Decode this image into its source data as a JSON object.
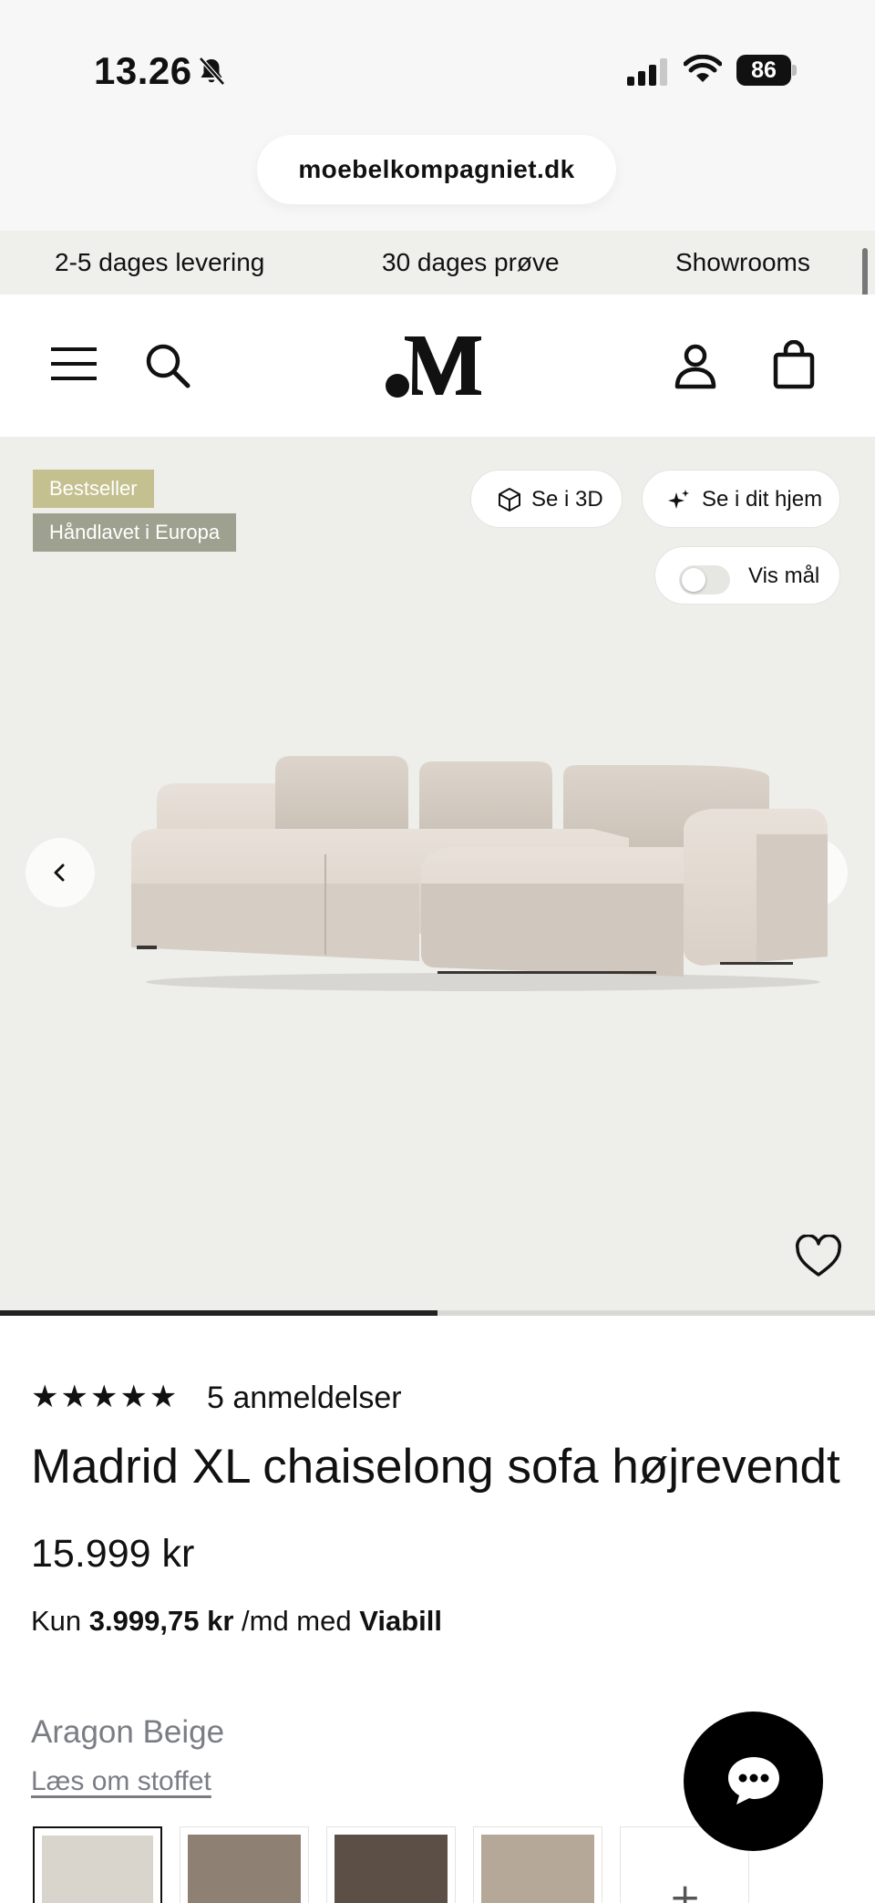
{
  "status_bar": {
    "time": "13.26",
    "battery": "86"
  },
  "browser": {
    "url": "moebelkompagniet.dk"
  },
  "usp_strip": {
    "items": [
      "2-5 dages levering",
      "30 dages prøve",
      "Showrooms"
    ]
  },
  "header": {
    "menu_icon": "hamburger-icon",
    "search_icon": "search-icon",
    "logo_icon": "logo-m",
    "account_icon": "user-icon",
    "cart_icon": "bag-icon"
  },
  "gallery": {
    "badges": [
      "Bestseller",
      "Håndlavet i Europa"
    ],
    "view_3d_label": "Se i 3D",
    "ar_label": "Se i dit hjem",
    "measure_label": "Vis mål",
    "measure_on": false,
    "image_progress": 0.5,
    "colors": {
      "background": "#eeeeeb",
      "badge_bestseller": "#c4c08f",
      "badge_handmade": "#9ea18f"
    }
  },
  "product": {
    "stars": "★★★★★",
    "rating": 5,
    "reviews_label": "5 anmeldelser",
    "title": "Madrid XL chaiselong sofa højrevendt",
    "price": "15.999 kr",
    "finance_prefix": "Kun",
    "finance_amount": "3.999,75 kr",
    "finance_mid": "/md med",
    "finance_provider": "Viabill",
    "color_name": "Aragon Beige",
    "fabric_link": "Læs om stoffet",
    "swatches": [
      {
        "color": "#d9d4cc",
        "selected": true
      },
      {
        "color": "#8e8174",
        "selected": false
      },
      {
        "color": "#5c5046",
        "selected": false
      },
      {
        "color": "#b5a899",
        "selected": false
      }
    ],
    "more_swatches": "+"
  },
  "chat": {
    "icon": "chat-bubble-icon"
  }
}
